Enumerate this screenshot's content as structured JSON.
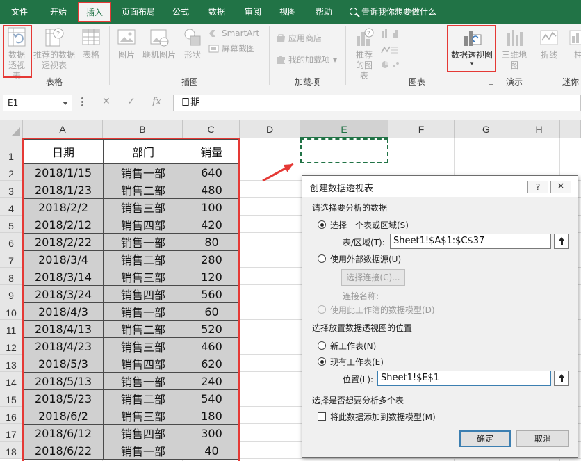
{
  "ribbon_tabs": [
    "文件",
    "开始",
    "插入",
    "页面布局",
    "公式",
    "数据",
    "审阅",
    "视图",
    "帮助"
  ],
  "tell_me": "告诉我你想要做什么",
  "groups": {
    "tables": {
      "label": "表格",
      "pivot": "数据透视表",
      "recommended": "推荐的数据透视表",
      "table": "表格"
    },
    "illustrations": {
      "label": "插图",
      "pictures": "图片",
      "online_pictures": "联机图片",
      "shapes": "形状",
      "smartart": "SmartArt",
      "screenshot": "屏幕截图"
    },
    "addins": {
      "label": "加载项",
      "store": "应用商店",
      "my_addins": "我的加载项"
    },
    "charts": {
      "label": "图表",
      "recommended": "推荐的图表",
      "pivot_chart": "数据透视图"
    },
    "tours": {
      "label": "演示",
      "map3d": "三维地图"
    },
    "sparklines": {
      "label": "迷你",
      "line": "折线",
      "column": "柱"
    }
  },
  "formula_bar": {
    "name_box": "E1",
    "fx": "fx",
    "content": "日期"
  },
  "columns": [
    "A",
    "B",
    "C",
    "D",
    "E",
    "F",
    "G",
    "H"
  ],
  "rows": [
    "1",
    "2",
    "3",
    "4",
    "5",
    "6",
    "7",
    "8",
    "9",
    "10",
    "11",
    "12",
    "13",
    "14",
    "15",
    "16",
    "17",
    "18"
  ],
  "table": {
    "headers": [
      "日期",
      "部门",
      "销量"
    ],
    "rows": [
      [
        "2018/1/15",
        "销售一部",
        "640"
      ],
      [
        "2018/1/23",
        "销售二部",
        "480"
      ],
      [
        "2018/2/2",
        "销售三部",
        "100"
      ],
      [
        "2018/2/12",
        "销售四部",
        "420"
      ],
      [
        "2018/2/22",
        "销售一部",
        "80"
      ],
      [
        "2018/3/4",
        "销售二部",
        "280"
      ],
      [
        "2018/3/14",
        "销售三部",
        "120"
      ],
      [
        "2018/3/24",
        "销售四部",
        "560"
      ],
      [
        "2018/4/3",
        "销售一部",
        "60"
      ],
      [
        "2018/4/13",
        "销售二部",
        "520"
      ],
      [
        "2018/4/23",
        "销售三部",
        "460"
      ],
      [
        "2018/5/3",
        "销售四部",
        "620"
      ],
      [
        "2018/5/13",
        "销售一部",
        "240"
      ],
      [
        "2018/5/23",
        "销售二部",
        "540"
      ],
      [
        "2018/6/2",
        "销售三部",
        "180"
      ],
      [
        "2018/6/12",
        "销售四部",
        "300"
      ],
      [
        "2018/6/22",
        "销售一部",
        "40"
      ]
    ]
  },
  "dialog": {
    "title": "创建数据透视表",
    "help": "?",
    "close": "✕",
    "section1": "请选择要分析的数据",
    "opt_range": "选择一个表或区域(S)",
    "range_label": "表/区域(T):",
    "range_value": "Sheet1!$A$1:$C$37",
    "opt_external": "使用外部数据源(U)",
    "choose_conn": "选择连接(C)...",
    "conn_name": "连接名称:",
    "opt_model": "使用此工作簿的数据模型(D)",
    "section2": "选择放置数据透视图的位置",
    "opt_new": "新工作表(N)",
    "opt_existing": "现有工作表(E)",
    "location_label": "位置(L):",
    "location_value": "Sheet1!$E$1",
    "section3": "选择是否想要分析多个表",
    "add_model": "将此数据添加到数据模型(M)",
    "ok": "确定",
    "cancel": "取消"
  },
  "colors": {
    "excel_green": "#217346",
    "highlight_red": "#e53935",
    "cell_fill": "#d0d0d0"
  }
}
